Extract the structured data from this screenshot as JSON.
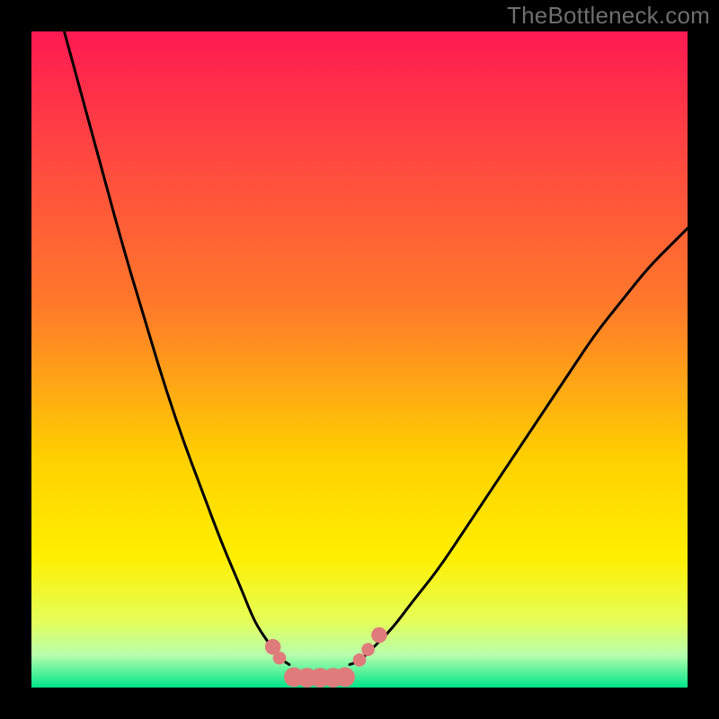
{
  "watermark": "TheBottleneck.com",
  "chart_data": {
    "type": "line",
    "title": "",
    "xlabel": "",
    "ylabel": "",
    "xlim": [
      0,
      100
    ],
    "ylim": [
      0,
      100
    ],
    "grid": false,
    "legend": false,
    "background_gradient": {
      "top": "#ff1a52",
      "upper_mid": "#ff7a2a",
      "mid": "#ffef00",
      "lower_mid": "#e4ff5a",
      "bottom": "#00e589"
    },
    "series": [
      {
        "name": "left-branch",
        "color": "#000000",
        "x": [
          5,
          8,
          11,
          14,
          17,
          20,
          23,
          26,
          29,
          32,
          34,
          36,
          37.5,
          38.5,
          39.3
        ],
        "y": [
          100,
          89,
          78,
          67,
          57,
          47,
          38,
          30,
          22,
          15,
          10,
          7,
          5,
          4,
          3.5
        ]
      },
      {
        "name": "right-branch",
        "color": "#000000",
        "x": [
          48.5,
          50,
          52,
          55,
          58,
          62,
          66,
          70,
          74,
          78,
          82,
          86,
          90,
          94,
          98,
          100
        ],
        "y": [
          3.5,
          4,
          6,
          9,
          13,
          18,
          24,
          30,
          36,
          42,
          48,
          54,
          59,
          64,
          68,
          70
        ]
      },
      {
        "name": "valley-floor",
        "color": "#e07b7b",
        "x": [
          40,
          41.5,
          43,
          44.5,
          46,
          47.5
        ],
        "y": [
          1.5,
          1.5,
          1.5,
          1.5,
          1.5,
          1.5
        ]
      }
    ],
    "markers": [
      {
        "name": "left-marker-1",
        "x": 36.8,
        "y": 6.2,
        "r": 1.2,
        "color": "#e07b7b"
      },
      {
        "name": "left-marker-2",
        "x": 37.8,
        "y": 4.5,
        "r": 1.0,
        "color": "#e07b7b"
      },
      {
        "name": "floor-marker-1",
        "x": 40.0,
        "y": 1.6,
        "r": 1.5,
        "color": "#e07b7b"
      },
      {
        "name": "floor-marker-2",
        "x": 42.0,
        "y": 1.5,
        "r": 1.5,
        "color": "#e07b7b"
      },
      {
        "name": "floor-marker-3",
        "x": 44.0,
        "y": 1.5,
        "r": 1.5,
        "color": "#e07b7b"
      },
      {
        "name": "floor-marker-4",
        "x": 46.0,
        "y": 1.5,
        "r": 1.5,
        "color": "#e07b7b"
      },
      {
        "name": "floor-marker-5",
        "x": 47.8,
        "y": 1.6,
        "r": 1.5,
        "color": "#e07b7b"
      },
      {
        "name": "right-marker-1",
        "x": 50.0,
        "y": 4.2,
        "r": 1.0,
        "color": "#e07b7b"
      },
      {
        "name": "right-marker-2",
        "x": 51.3,
        "y": 5.8,
        "r": 1.0,
        "color": "#e07b7b"
      },
      {
        "name": "right-marker-3",
        "x": 53.0,
        "y": 8.0,
        "r": 1.2,
        "color": "#e07b7b"
      }
    ]
  }
}
